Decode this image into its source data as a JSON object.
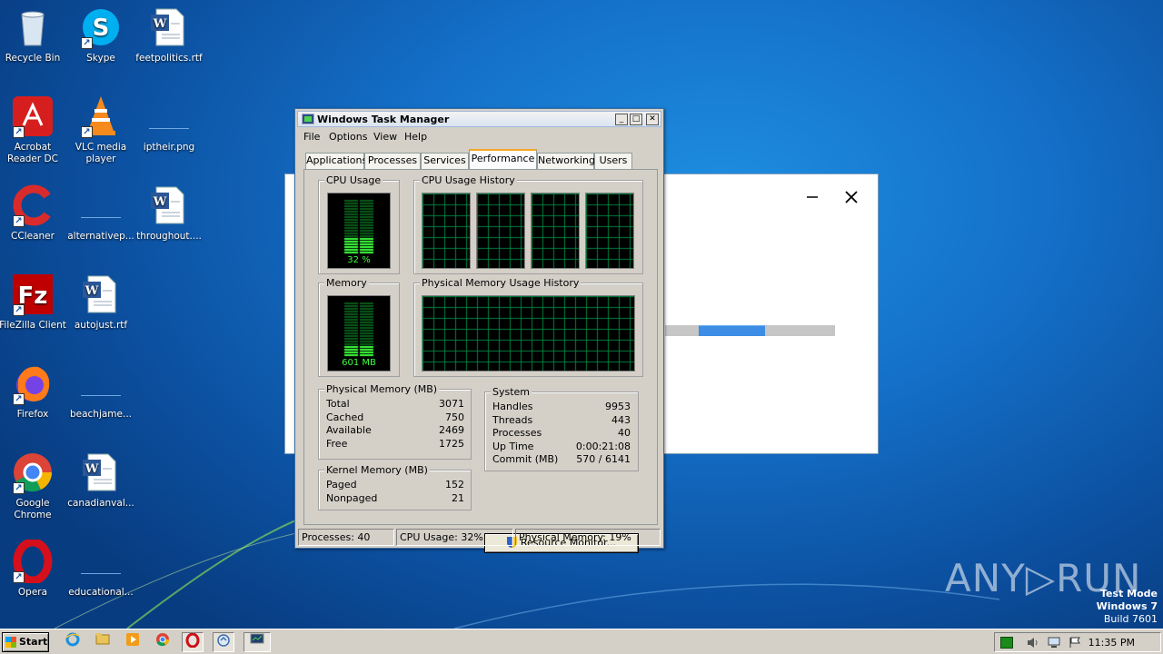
{
  "desktop": {
    "icons": [
      {
        "label": "Recycle Bin",
        "icon": "recycle-bin-icon"
      },
      {
        "label": "Skype",
        "icon": "skype-icon"
      },
      {
        "label": "feetpolitics.rtf",
        "icon": "word-doc-icon"
      },
      {
        "label": "Acrobat Reader DC",
        "icon": "acrobat-icon"
      },
      {
        "label": "VLC media player",
        "icon": "vlc-icon"
      },
      {
        "label": "iptheir.png",
        "icon": "blank-file-icon"
      },
      {
        "label": "CCleaner",
        "icon": "ccleaner-icon"
      },
      {
        "label": "alternativep...",
        "icon": "blank-file-icon"
      },
      {
        "label": "throughout....",
        "icon": "word-doc-icon"
      },
      {
        "label": "FileZilla Client",
        "icon": "filezilla-icon"
      },
      {
        "label": "autojust.rtf",
        "icon": "word-doc-icon"
      },
      {
        "label": "Firefox",
        "icon": "firefox-icon"
      },
      {
        "label": "beachjame...",
        "icon": "blank-file-icon"
      },
      {
        "label": "Google Chrome",
        "icon": "chrome-icon"
      },
      {
        "label": "canadianval...",
        "icon": "word-doc-icon"
      },
      {
        "label": "Opera",
        "icon": "opera-icon"
      },
      {
        "label": "educational...",
        "icon": "blank-file-icon"
      }
    ]
  },
  "background_dialog": {
    "minimize_symbol": "–",
    "close_symbol": "✕",
    "progress_fraction": 0.59
  },
  "task_manager": {
    "title": "Windows Task Manager",
    "title_buttons": {
      "minimize": "_",
      "maximize": "□",
      "close": "✕"
    },
    "menu": [
      "File",
      "Options",
      "View",
      "Help"
    ],
    "tabs": [
      "Applications",
      "Processes",
      "Services",
      "Performance",
      "Networking",
      "Users"
    ],
    "active_tab": "Performance",
    "cpu_usage": {
      "label": "CPU Usage",
      "value": "32 %",
      "percent": 32
    },
    "cpu_history": {
      "label": "CPU Usage History",
      "cores": 4
    },
    "memory": {
      "label": "Memory",
      "value": "601 MB",
      "fraction": 0.19
    },
    "memory_history": {
      "label": "Physical Memory Usage History"
    },
    "physical_memory": {
      "label": "Physical Memory (MB)",
      "rows": [
        {
          "key": "Total",
          "value": "3071"
        },
        {
          "key": "Cached",
          "value": "750"
        },
        {
          "key": "Available",
          "value": "2469"
        },
        {
          "key": "Free",
          "value": "1725"
        }
      ]
    },
    "kernel_memory": {
      "label": "Kernel Memory (MB)",
      "rows": [
        {
          "key": "Paged",
          "value": "152"
        },
        {
          "key": "Nonpaged",
          "value": "21"
        }
      ]
    },
    "system": {
      "label": "System",
      "rows": [
        {
          "key": "Handles",
          "value": "9953"
        },
        {
          "key": "Threads",
          "value": "443"
        },
        {
          "key": "Processes",
          "value": "40"
        },
        {
          "key": "Up Time",
          "value": "0:00:21:08"
        },
        {
          "key": "Commit (MB)",
          "value": "570 / 6141"
        }
      ]
    },
    "resource_monitor_button": "Resource Monitor...",
    "status": {
      "processes": "Processes: 40",
      "cpu": "CPU Usage: 32%",
      "memory": "Physical Memory: 19%"
    }
  },
  "taskbar": {
    "start_label": "Start",
    "quick_launch": [
      "ie-icon",
      "explorer-icon",
      "media-player-icon",
      "chrome-icon",
      "opera-icon",
      "sync-icon",
      "task-manager-icon"
    ],
    "clock": "11:35 PM"
  },
  "watermark": "ANY▷RUN",
  "test_mode": {
    "line1": "Test Mode",
    "line2": "Windows 7",
    "line3": "Build 7601"
  },
  "colors": {
    "meter_green": "#3cff3c",
    "grid_green": "#008040",
    "active_tab_accent": "#f5a623"
  }
}
